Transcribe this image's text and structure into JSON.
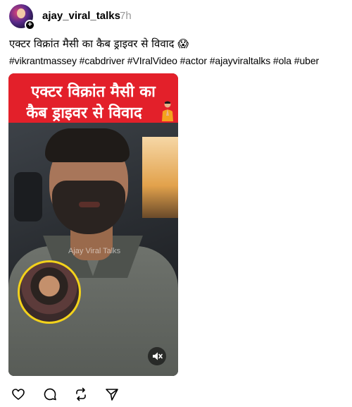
{
  "post": {
    "username": "ajay_viral_talks",
    "timestamp": "7h",
    "caption": "एक्टर विक्रांत मैसी का कैब ड्राइवर से विवाद 😱",
    "hashtags": "#vikrantmassey #cabdriver #VIralVideo #actor #ajayviraltalks #ola #uber"
  },
  "media": {
    "banner_line1": "एक्टर विक्रांत मैसी का",
    "banner_line2": "कैब ड्राइवर से विवाद",
    "watermark": "Ajay Viral Talks",
    "banner_color": "#e3202a",
    "inset_border_color": "#f3d21b"
  },
  "actions": {
    "icons": [
      "heart-icon",
      "comment-icon",
      "repost-icon",
      "share-icon"
    ]
  }
}
